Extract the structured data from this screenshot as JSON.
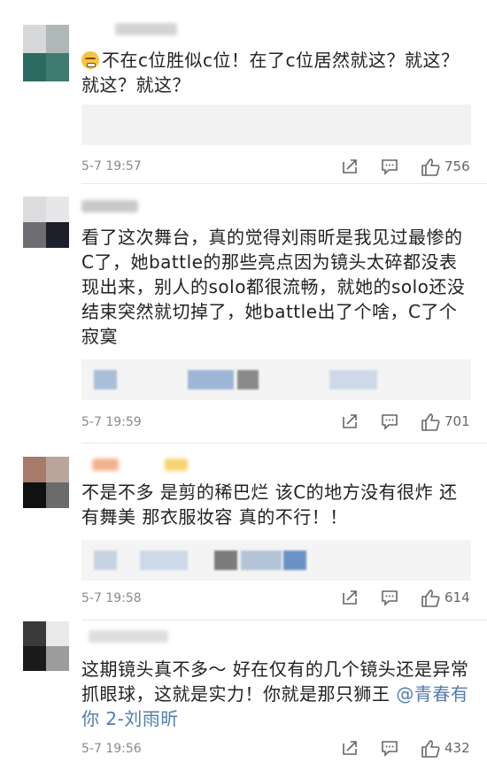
{
  "comments": [
    {
      "text": "不在c位胜似c位！在了c位居然就这？就这？就这？就这？",
      "time": "5-7 19:57",
      "likes": "756",
      "has_emoji": true
    },
    {
      "text": "看了这次舞台，真的觉得刘雨昕是我见过最惨的C了，她battle的那些亮点因为镜头太碎都没表现出来，别人的solo都很流畅，就她的solo还没结束突然就切掉了，她battle出了个啥，C了个寂寞",
      "time": "5-7 19:59",
      "likes": "701"
    },
    {
      "text": "不是不多 是剪的稀巴烂 该C的地方没有很炸 还有舞美 那衣服妆容 真的不行！！",
      "time": "5-7 19:58",
      "likes": "614"
    },
    {
      "text": "这期镜头真不多～ 好在仅有的几个镜头还是异常抓眼球，这就是实力！你就是那只狮王 ",
      "mention": "@青春有你 2-刘雨昕",
      "time": "5-7 19:56",
      "likes": "432"
    }
  ],
  "icons": [
    "repost-icon",
    "comment-icon",
    "like-icon"
  ],
  "colors": {
    "mention": "#507daf",
    "meta": "#8a8a8a",
    "repost_bg": "#f2f2f2"
  }
}
